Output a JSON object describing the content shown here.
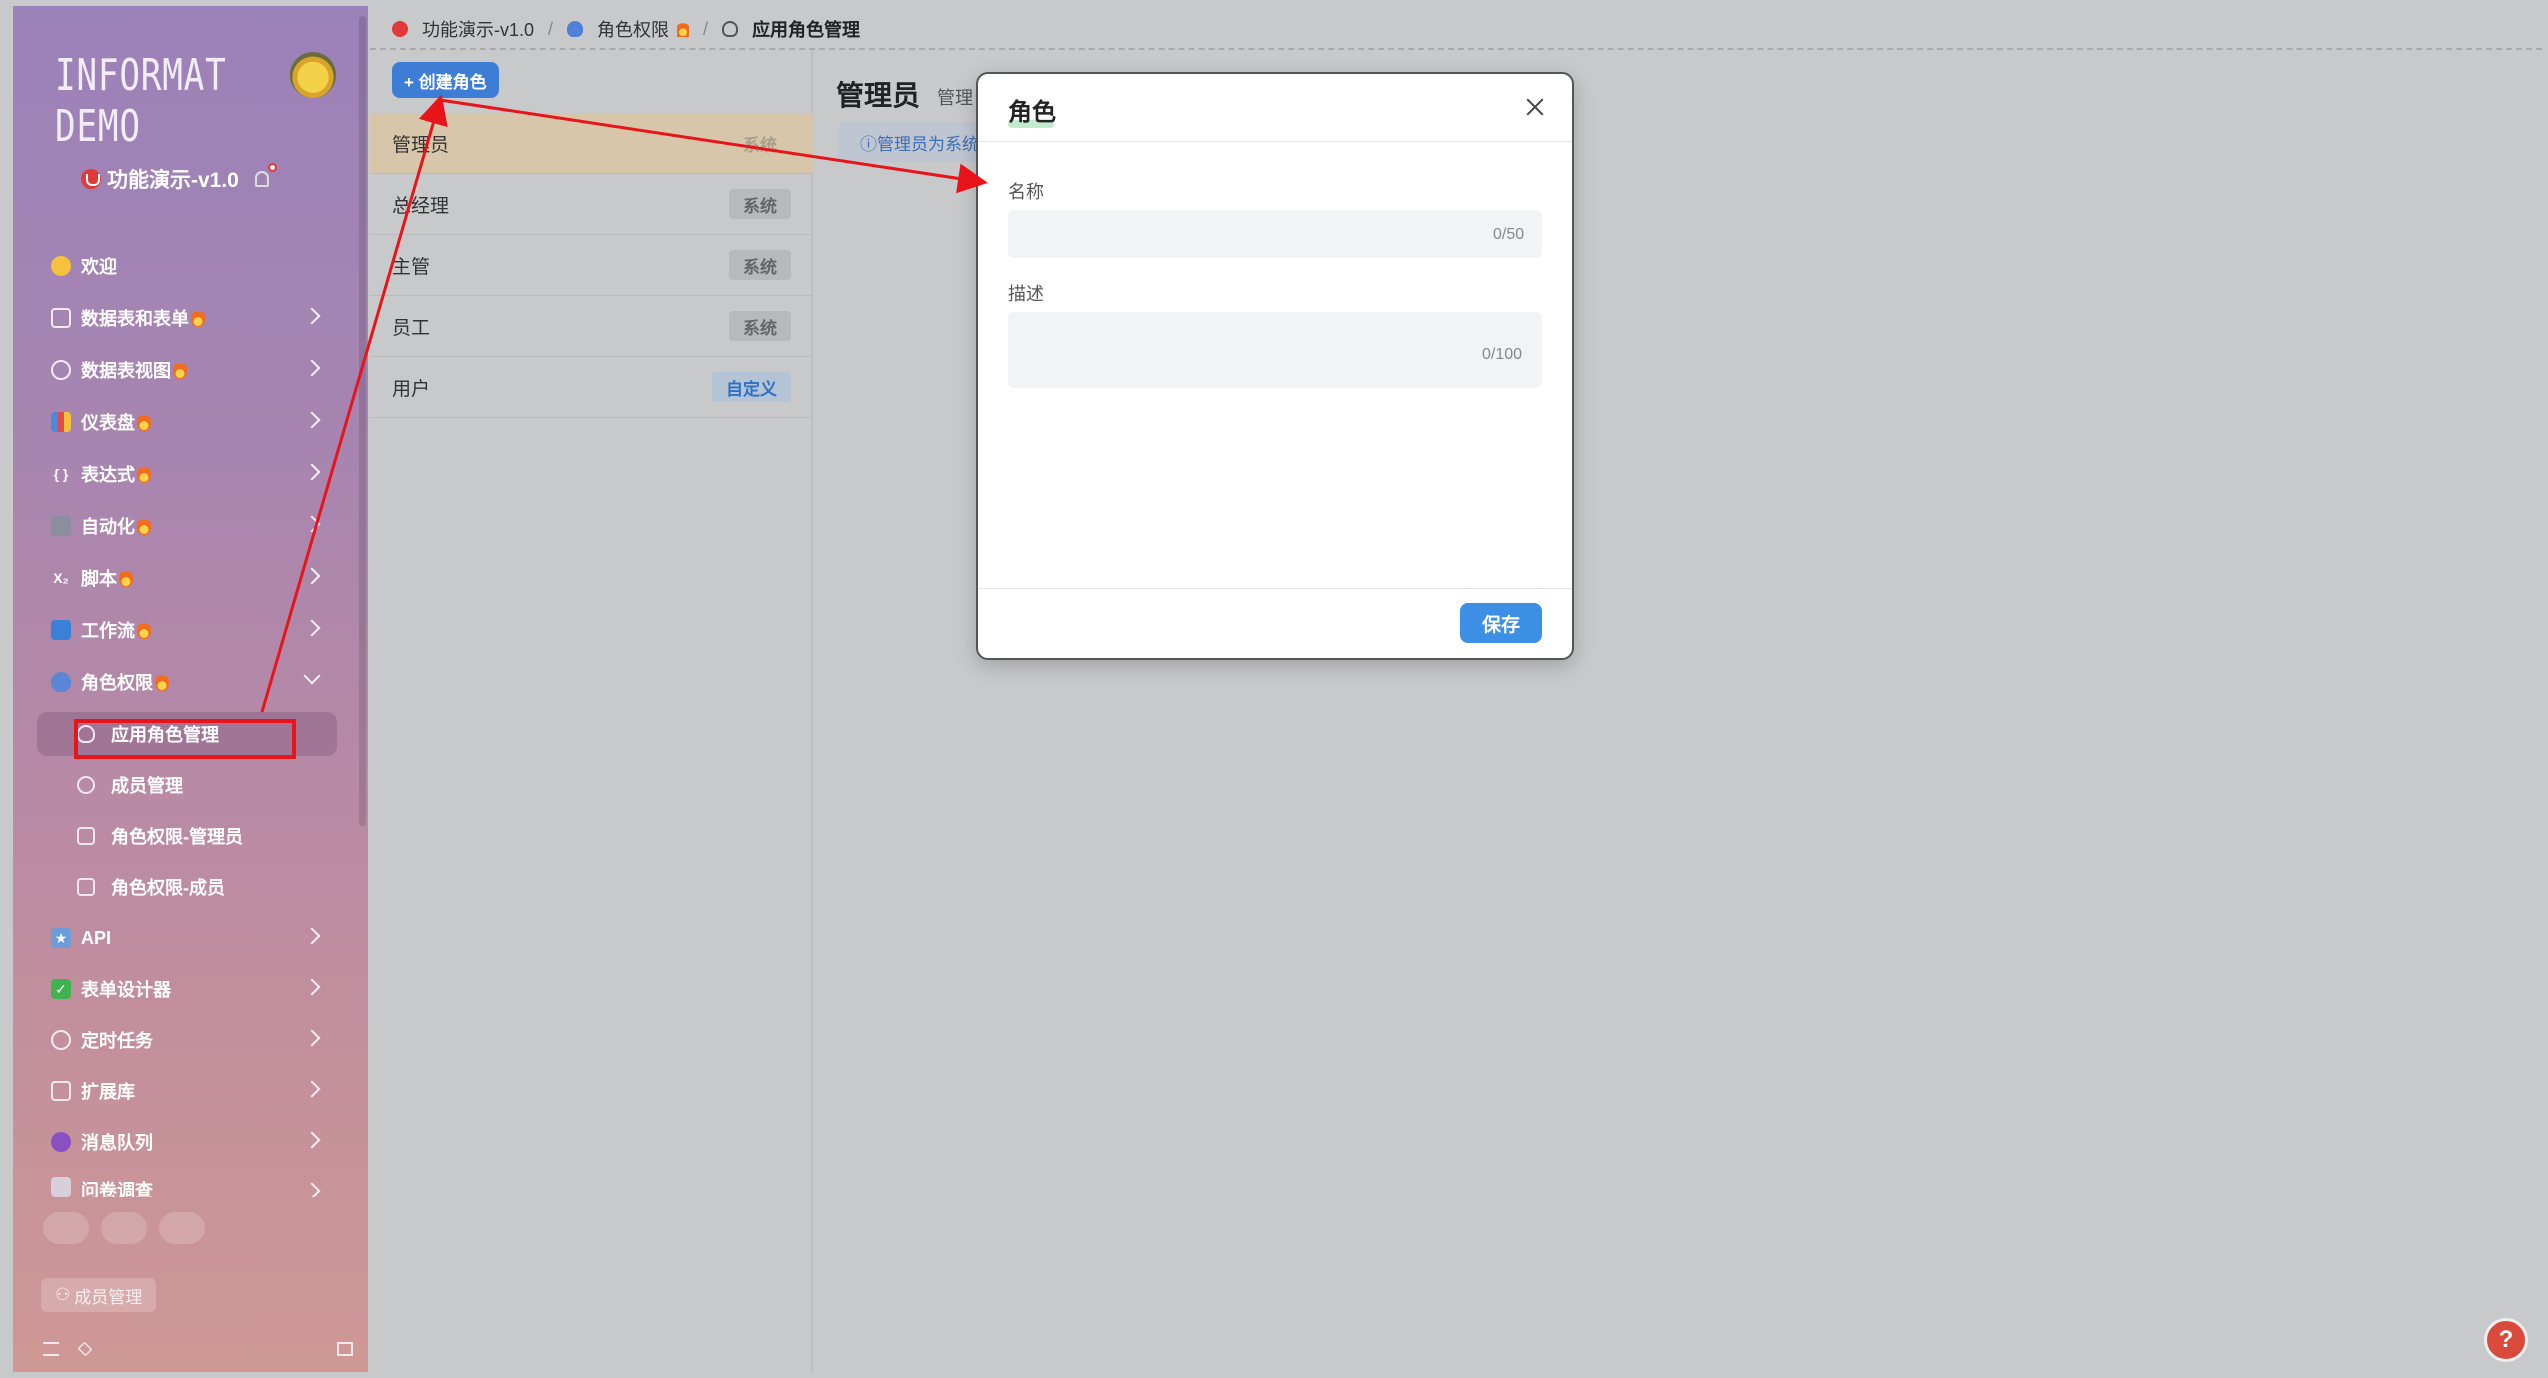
{
  "brand": {
    "logo_text": "INFORMAT DEMO"
  },
  "app": {
    "name": "功能演示-v1.0"
  },
  "sidebar": {
    "items": [
      {
        "label": "欢迎",
        "icon": "smile-icon",
        "expandable": false
      },
      {
        "label": "数据表和表单",
        "icon": "table-icon",
        "expandable": true
      },
      {
        "label": "数据表视图",
        "icon": "view-icon",
        "expandable": true
      },
      {
        "label": "仪表盘",
        "icon": "chart-icon",
        "expandable": true
      },
      {
        "label": "表达式",
        "icon": "braces-icon",
        "expandable": true
      },
      {
        "label": "自动化",
        "icon": "robot-icon",
        "expandable": true
      },
      {
        "label": "脚本",
        "icon": "script-icon",
        "expandable": true
      },
      {
        "label": "工作流",
        "icon": "workflow-icon",
        "expandable": true
      },
      {
        "label": "角色权限",
        "icon": "shield-icon",
        "expandable": true,
        "expanded": true
      }
    ],
    "subitems": [
      {
        "label": "应用角色管理",
        "icon": "shield-icon",
        "active": true
      },
      {
        "label": "成员管理",
        "icon": "member-icon"
      },
      {
        "label": "角色权限-管理员",
        "icon": "table-icon"
      },
      {
        "label": "角色权限-成员",
        "icon": "table-icon"
      }
    ],
    "items2": [
      {
        "label": "API",
        "icon": "api-icon"
      },
      {
        "label": "表单设计器",
        "icon": "check-icon"
      },
      {
        "label": "定时任务",
        "icon": "timer-icon"
      },
      {
        "label": "扩展库",
        "icon": "library-icon"
      },
      {
        "label": "消息队列",
        "icon": "queue-icon"
      },
      {
        "label": "问卷调查",
        "icon": "survey-icon"
      }
    ],
    "member_chip": "成员管理"
  },
  "breadcrumb": {
    "items": [
      "功能演示-v1.0",
      "角色权限",
      "应用角色管理"
    ]
  },
  "role_panel": {
    "create_label": "+ 创建角色",
    "roles": [
      {
        "name": "管理员",
        "tag": "系统",
        "selected": true
      },
      {
        "name": "总经理",
        "tag": "系统"
      },
      {
        "name": "主管",
        "tag": "系统"
      },
      {
        "name": "员工",
        "tag": "系统"
      },
      {
        "name": "用户",
        "tag": "自定义",
        "custom": true
      }
    ]
  },
  "detail": {
    "title": "管理员",
    "subtitle": "管理",
    "info": "ⓘ管理员为系统"
  },
  "modal": {
    "title": "角色",
    "name_label": "名称",
    "name_value": "",
    "name_count": "0/50",
    "desc_label": "描述",
    "desc_value": "",
    "desc_count": "0/100",
    "save_label": "保存"
  },
  "help": {
    "label": "?"
  },
  "colors": {
    "accent": "#3d8fe6",
    "annotation": "#e8141a",
    "selected_row": "#d8c6aa"
  }
}
